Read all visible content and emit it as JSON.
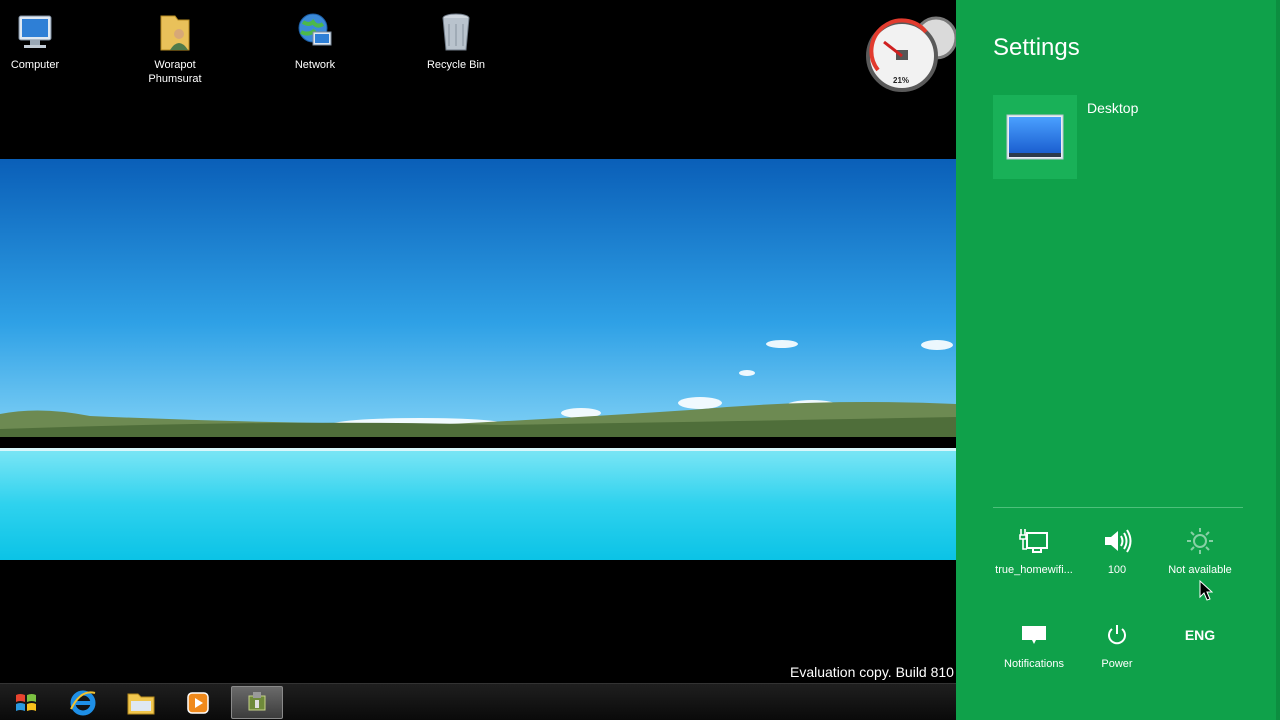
{
  "desktop": {
    "icons": [
      {
        "label": "Computer",
        "icon": "computer-icon"
      },
      {
        "label": "Worapot\nPhumsurat",
        "icon": "user-folder-icon"
      },
      {
        "label": "Network",
        "icon": "network-icon"
      },
      {
        "label": "Recycle Bin",
        "icon": "recycle-bin-icon"
      }
    ],
    "watermark": "Evaluation copy. Build 810",
    "gadget": {
      "cpu_readout": "21%"
    }
  },
  "taskbar": {
    "items": [
      {
        "name": "start-button",
        "icon": "windows-logo-icon"
      },
      {
        "name": "internet-explorer",
        "icon": "ie-icon"
      },
      {
        "name": "file-explorer",
        "icon": "folder-icon"
      },
      {
        "name": "media-player",
        "icon": "media-player-icon"
      },
      {
        "name": "active-app",
        "icon": "app-icon",
        "active": true
      }
    ]
  },
  "charm": {
    "title": "Settings",
    "tiles": [
      {
        "label": "Desktop",
        "icon": "desktop-monitor-icon"
      }
    ],
    "quick_settings": {
      "network": "true_homewifi...",
      "volume": "100",
      "brightness": "Not available",
      "notifications": "Notifications",
      "power": "Power",
      "keyboard": "ENG"
    },
    "colors": {
      "background": "#0fa14a",
      "tile": "#19b158"
    }
  }
}
